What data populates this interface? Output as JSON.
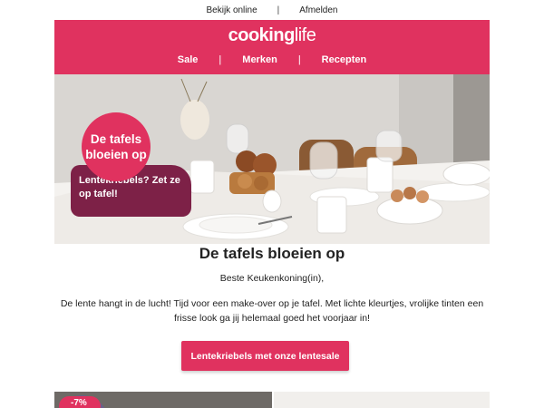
{
  "top_links": {
    "view_online": "Bekijk online",
    "separator": "|",
    "unsubscribe": "Afmelden"
  },
  "header": {
    "logo_bold": "cooking",
    "logo_light": "life",
    "nav": [
      {
        "label": "Sale"
      },
      {
        "label": "Merken"
      },
      {
        "label": "Recepten"
      }
    ],
    "nav_separator": "|",
    "brand_color": "#e0325f"
  },
  "hero": {
    "badge_title": "De tafels bloeien op",
    "badge_subtitle": "Lentekriebels? Zet ze op tafel!",
    "badge_tag_color": "#7d2147"
  },
  "content": {
    "headline": "De tafels bloeien op",
    "salutation": "Beste Keukenkoning(in),",
    "body": "De lente hangt in de lucht! Tijd voor een make-over op je tafel. Met lichte kleurtjes, vrolijke tinten een frisse look ga jij helemaal goed het voorjaar in!",
    "cta_label": "Lentekriebels met onze lentesale"
  },
  "products": {
    "discount_badge": "-7%"
  }
}
